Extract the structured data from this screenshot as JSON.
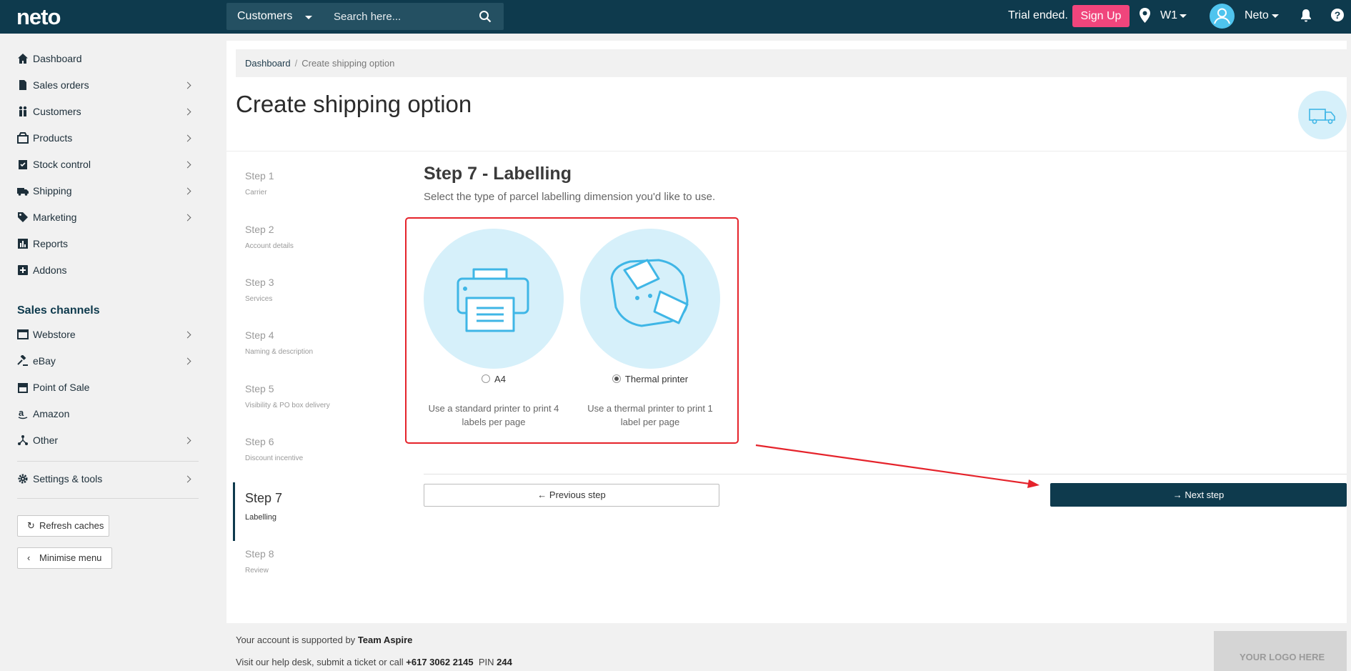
{
  "header": {
    "logo": "neto",
    "search_scope": "Customers",
    "search_placeholder": "Search here...",
    "trial_text": "Trial ended.",
    "signup_label": "Sign Up",
    "location_label": "W1",
    "user_label": "Neto",
    "help_label": "?"
  },
  "sidebar": {
    "items": [
      {
        "label": "Dashboard",
        "icon": "home-icon"
      },
      {
        "label": "Sales orders",
        "icon": "document-icon"
      },
      {
        "label": "Customers",
        "icon": "users-icon"
      },
      {
        "label": "Products",
        "icon": "products-icon"
      },
      {
        "label": "Stock control",
        "icon": "clipboard-icon"
      },
      {
        "label": "Shipping",
        "icon": "truck-icon"
      },
      {
        "label": "Marketing",
        "icon": "tag-icon"
      },
      {
        "label": "Reports",
        "icon": "chart-icon"
      },
      {
        "label": "Addons",
        "icon": "plus-box-icon"
      }
    ],
    "channels_heading": "Sales channels",
    "channels": [
      {
        "label": "Webstore",
        "icon": "browser-icon"
      },
      {
        "label": "eBay",
        "icon": "gavel-icon"
      },
      {
        "label": "Point of Sale",
        "icon": "store-icon"
      },
      {
        "label": "Amazon",
        "icon": "amazon-icon"
      },
      {
        "label": "Other",
        "icon": "network-icon"
      }
    ],
    "settings_label": "Settings & tools",
    "refresh_label": "Refresh caches",
    "minimise_label": "Minimise menu"
  },
  "breadcrumb": {
    "home": "Dashboard",
    "current": "Create shipping option"
  },
  "page_title": "Create shipping option",
  "steps": [
    {
      "title": "Step 1",
      "sub": "Carrier"
    },
    {
      "title": "Step 2",
      "sub": "Account details"
    },
    {
      "title": "Step 3",
      "sub": "Services"
    },
    {
      "title": "Step 4",
      "sub": "Naming & description"
    },
    {
      "title": "Step 5",
      "sub": "Visibility & PO box delivery"
    },
    {
      "title": "Step 6",
      "sub": "Discount incentive"
    },
    {
      "title": "Step 7",
      "sub": "Labelling"
    },
    {
      "title": "Step 8",
      "sub": "Review"
    }
  ],
  "step_content": {
    "heading": "Step 7 - Labelling",
    "description": "Select the type of parcel labelling dimension you'd like to use.",
    "options": [
      {
        "label": "A4",
        "checked": false,
        "desc": "Use a standard printer to print 4 labels per page"
      },
      {
        "label": "Thermal printer",
        "checked": true,
        "desc": "Use a thermal printer to print 1 label per page"
      }
    ],
    "prev_label": "Previous step",
    "next_label": "Next step"
  },
  "footer": {
    "support_prefix": "Your account is supported by",
    "support_team": "Team Aspire",
    "help_prefix": "Visit our",
    "help_link": "help desk",
    "ticket_link": "submit a ticket",
    "call_text": "or call",
    "phone": "+617 3062 2145",
    "pin_label": "PIN",
    "pin": "244",
    "logo_placeholder": "YOUR LOGO HERE"
  },
  "colors": {
    "topbar": "#0e3a4d",
    "accent": "#f0457c",
    "option_circle": "#d6f0fa",
    "icon_stroke": "#3fb6e6",
    "annotation": "#e5232b"
  }
}
